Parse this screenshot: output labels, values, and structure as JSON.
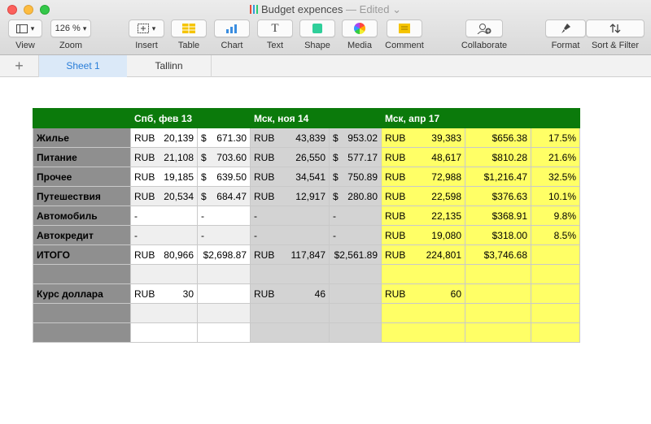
{
  "window": {
    "title": "Budget expences",
    "edited": "— Edited"
  },
  "toolbar": {
    "view": "View",
    "zoom_value": "126 %",
    "zoom": "Zoom",
    "insert": "Insert",
    "table": "Table",
    "chart": "Chart",
    "text": "Text",
    "text_glyph": "T",
    "shape": "Shape",
    "media": "Media",
    "comment": "Comment",
    "collaborate": "Collaborate",
    "format": "Format",
    "sort_filter": "Sort & Filter"
  },
  "tabs": {
    "add": "+",
    "sheet1": "Sheet 1",
    "sheet2": "Tallinn"
  },
  "table": {
    "headers": [
      "",
      "Спб, фев 13",
      "",
      "Мск, ноя 14",
      "",
      "Мск, апр 17",
      "",
      ""
    ],
    "rows": [
      {
        "label": "Жилье",
        "c1a": "RUB",
        "c1b": "20,139",
        "c2a": "$",
        "c2b": "671.30",
        "c3a": "RUB",
        "c3b": "43,839",
        "c4a": "$",
        "c4b": "953.02",
        "c5a": "RUB",
        "c5b": "39,383",
        "c6": "$656.38",
        "c7": "17.5%"
      },
      {
        "label": "Питание",
        "c1a": "RUB",
        "c1b": "21,108",
        "c2a": "$",
        "c2b": "703.60",
        "c3a": "RUB",
        "c3b": "26,550",
        "c4a": "$",
        "c4b": "577.17",
        "c5a": "RUB",
        "c5b": "48,617",
        "c6": "$810.28",
        "c7": "21.6%"
      },
      {
        "label": "Прочее",
        "c1a": "RUB",
        "c1b": "19,185",
        "c2a": "$",
        "c2b": "639.50",
        "c3a": "RUB",
        "c3b": "34,541",
        "c4a": "$",
        "c4b": "750.89",
        "c5a": "RUB",
        "c5b": "72,988",
        "c6": "$1,216.47",
        "c7": "32.5%"
      },
      {
        "label": "Путешествия",
        "c1a": "RUB",
        "c1b": "20,534",
        "c2a": "$",
        "c2b": "684.47",
        "c3a": "RUB",
        "c3b": "12,917",
        "c4a": "$",
        "c4b": "280.80",
        "c5a": "RUB",
        "c5b": "22,598",
        "c6": "$376.63",
        "c7": "10.1%"
      },
      {
        "label": "Автомобиль",
        "c1a": "-",
        "c1b": "",
        "c2a": "-",
        "c2b": "",
        "c3a": "-",
        "c3b": "",
        "c4a": "-",
        "c4b": "",
        "c5a": "RUB",
        "c5b": "22,135",
        "c6": "$368.91",
        "c7": "9.8%"
      },
      {
        "label": "Автокредит",
        "c1a": "-",
        "c1b": "",
        "c2a": "-",
        "c2b": "",
        "c3a": "-",
        "c3b": "",
        "c4a": "-",
        "c4b": "",
        "c5a": "RUB",
        "c5b": "19,080",
        "c6": "$318.00",
        "c7": "8.5%"
      },
      {
        "label": "ИТОГО",
        "c1a": "RUB",
        "c1b": "80,966",
        "c2a": "",
        "c2b": "$2,698.87",
        "c3a": "RUB",
        "c3b": "117,847",
        "c4a": "",
        "c4b": "$2,561.89",
        "c5a": "RUB",
        "c5b": "224,801",
        "c6": "$3,746.68",
        "c7": ""
      },
      {
        "label": "",
        "c1a": "",
        "c1b": "",
        "c2a": "",
        "c2b": "",
        "c3a": "",
        "c3b": "",
        "c4a": "",
        "c4b": "",
        "c5a": "",
        "c5b": "",
        "c6": "",
        "c7": ""
      },
      {
        "label": "Курс доллара",
        "c1a": "RUB",
        "c1b": "30",
        "c2a": "",
        "c2b": "",
        "c3a": "RUB",
        "c3b": "46",
        "c4a": "",
        "c4b": "",
        "c5a": "RUB",
        "c5b": "60",
        "c6": "",
        "c7": ""
      },
      {
        "label": "",
        "c1a": "",
        "c1b": "",
        "c2a": "",
        "c2b": "",
        "c3a": "",
        "c3b": "",
        "c4a": "",
        "c4b": "",
        "c5a": "",
        "c5b": "",
        "c6": "",
        "c7": ""
      },
      {
        "label": "",
        "c1a": "",
        "c1b": "",
        "c2a": "",
        "c2b": "",
        "c3a": "",
        "c3b": "",
        "c4a": "",
        "c4b": "",
        "c5a": "",
        "c5b": "",
        "c6": "",
        "c7": ""
      }
    ]
  },
  "colors": {
    "header_green": "#0b7a0b",
    "label_gray": "#8f8f8f",
    "moscow14_gray": "#d3d3d3",
    "moscow17_yellow": "#ffff66",
    "tab_active": "#2a7ed8"
  },
  "icons": [
    "close-icon",
    "minimize-icon",
    "maximize-icon",
    "numbers-doc-icon",
    "sidebar-view-icon",
    "chevron-down-icon",
    "insert-plus-icon",
    "table-icon",
    "bar-chart-icon",
    "text-icon",
    "shape-square-icon",
    "media-flower-icon",
    "comment-icon",
    "collaborate-person-icon",
    "format-brush-icon",
    "sort-arrows-icon"
  ]
}
